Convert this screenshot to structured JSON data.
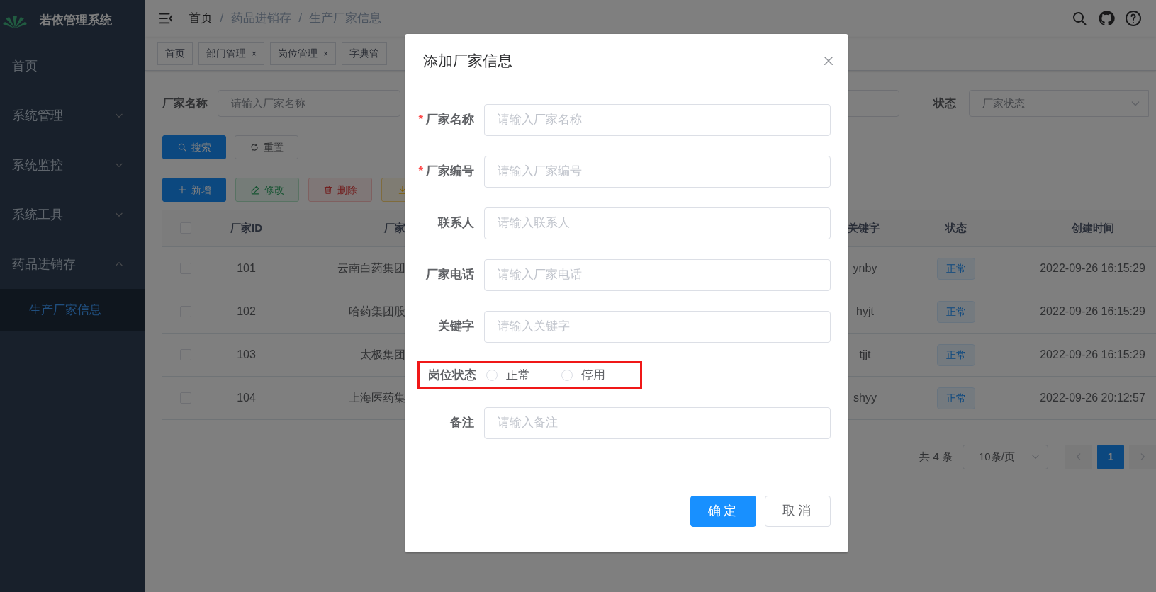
{
  "sidebar": {
    "title": "若依管理系统",
    "items": [
      {
        "label": "首页",
        "kind": "link"
      },
      {
        "label": "系统管理",
        "kind": "group",
        "expanded": false
      },
      {
        "label": "系统监控",
        "kind": "group",
        "expanded": false
      },
      {
        "label": "系统工具",
        "kind": "group",
        "expanded": false
      },
      {
        "label": "药品进销存",
        "kind": "group",
        "expanded": true,
        "children": [
          {
            "label": "生产厂家信息",
            "selected": true
          }
        ]
      }
    ]
  },
  "breadcrumb": {
    "separator": "/",
    "items": [
      "首页",
      "药品进销存",
      "生产厂家信息"
    ]
  },
  "tags": [
    {
      "label": "首页"
    },
    {
      "label": "部门管理",
      "close": "×"
    },
    {
      "label": "岗位管理",
      "close": "×"
    },
    {
      "label": "字典管"
    }
  ],
  "search_form": {
    "fields": [
      {
        "kind": "input",
        "label": "厂家名称",
        "placeholder": "请输入厂家名称"
      },
      {
        "kind": "input-cut"
      },
      {
        "kind": "select",
        "label": "状态",
        "placeholder": "厂家状态"
      }
    ],
    "buttons": [
      {
        "kind": "search",
        "label": "搜索"
      },
      {
        "kind": "reset",
        "label": "重置"
      }
    ]
  },
  "toolbar": [
    {
      "kind": "add",
      "label": "新增",
      "disabled": false
    },
    {
      "kind": "edit",
      "label": "修改",
      "disabled": true
    },
    {
      "kind": "delete",
      "label": "删除",
      "disabled": true
    },
    {
      "kind": "export",
      "disabled": false
    }
  ],
  "table": {
    "header_checked": false,
    "columns": [
      "厂家ID",
      "厂家",
      "关键字",
      "状态",
      "创建时间"
    ],
    "rows": [
      {
        "checked": false,
        "id": "101",
        "name": "云南白药集团",
        "keyword": "ynby",
        "status": "正常",
        "created": "2022-09-26 16:15:29"
      },
      {
        "checked": false,
        "id": "102",
        "name": "哈药集团股",
        "keyword": "hyjt",
        "status": "正常",
        "created": "2022-09-26 16:15:29"
      },
      {
        "checked": false,
        "id": "103",
        "name": "太极集团",
        "keyword": "tjjt",
        "status": "正常",
        "created": "2022-09-26 16:15:29"
      },
      {
        "checked": false,
        "id": "104",
        "name": "上海医药集",
        "keyword": "shyy",
        "status": "正常",
        "created": "2022-09-26 20:12:57"
      }
    ]
  },
  "pagination": {
    "total": "共 4 条",
    "page_size": "10条/页",
    "pages": [
      {
        "label": "1",
        "selected": true
      }
    ]
  },
  "dialog": {
    "title": "添加厂家信息",
    "fields": [
      {
        "kind": "input",
        "label": "厂家名称",
        "required_mark": "*",
        "placeholder": "请输入厂家名称"
      },
      {
        "kind": "input",
        "label": "厂家编号",
        "required_mark": "*",
        "placeholder": "请输入厂家编号"
      },
      {
        "kind": "input",
        "label": "联系人",
        "placeholder": "请输入联系人"
      },
      {
        "kind": "input",
        "label": "厂家电话",
        "placeholder": "请输入厂家电话"
      },
      {
        "kind": "input",
        "label": "关键字",
        "placeholder": "请输入关键字"
      },
      {
        "kind": "radio",
        "label": "岗位状态",
        "highlighted": true,
        "options": [
          {
            "label": "正常",
            "selected": false
          },
          {
            "label": "停用",
            "selected": false
          }
        ]
      },
      {
        "kind": "input",
        "label": "备注",
        "placeholder": "请输入备注"
      }
    ],
    "buttons": [
      {
        "kind": "primary",
        "label": "确定"
      },
      {
        "kind": "default",
        "label": "取消"
      }
    ]
  }
}
